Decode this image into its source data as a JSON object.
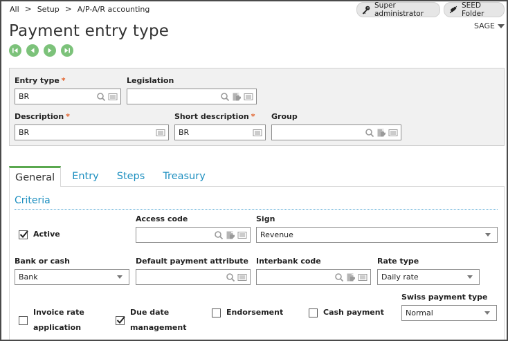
{
  "breadcrumb": [
    "All",
    "Setup",
    "A/P-A/R accounting"
  ],
  "topbar": {
    "admin_label": "Super administrator",
    "folder_label": "SEED Folder"
  },
  "page": {
    "title": "Payment entry type",
    "sage_label": "SAGE"
  },
  "header": {
    "entry_type": {
      "label": "Entry type",
      "value": "BR"
    },
    "legislation": {
      "label": "Legislation",
      "value": ""
    },
    "description": {
      "label": "Description",
      "value": "BR"
    },
    "short_description": {
      "label": "Short description",
      "value": "BR"
    },
    "group": {
      "label": "Group",
      "value": ""
    }
  },
  "tabs": [
    {
      "label": "General"
    },
    {
      "label": "Entry"
    },
    {
      "label": "Steps"
    },
    {
      "label": "Treasury"
    }
  ],
  "criteria": {
    "title": "Criteria",
    "active": {
      "label": "Active",
      "checked": true
    },
    "access_code": {
      "label": "Access code",
      "value": ""
    },
    "sign": {
      "label": "Sign",
      "value": "Revenue"
    },
    "bank_or_cash": {
      "label": "Bank or cash",
      "value": "Bank"
    },
    "default_payment_attribute": {
      "label": "Default payment attribute",
      "value": ""
    },
    "interbank_code": {
      "label": "Interbank code",
      "value": ""
    },
    "rate_type": {
      "label": "Rate type",
      "value": "Daily rate"
    },
    "invoice_rate": {
      "label_line1": "Invoice rate",
      "label_line2": "application",
      "checked": false
    },
    "due_date": {
      "label_line1": "Due date",
      "label_line2": "management",
      "checked": true
    },
    "endorsement": {
      "label": "Endorsement",
      "checked": false
    },
    "cash_payment": {
      "label": "Cash payment",
      "checked": false
    },
    "swiss_payment_type": {
      "label": "Swiss payment type",
      "value": "Normal"
    }
  },
  "colors": {
    "accent_blue": "#1d8fc0",
    "nav_green": "#7cc27a",
    "required": "#e2612a",
    "tab_active_bar": "#5aa84f"
  }
}
